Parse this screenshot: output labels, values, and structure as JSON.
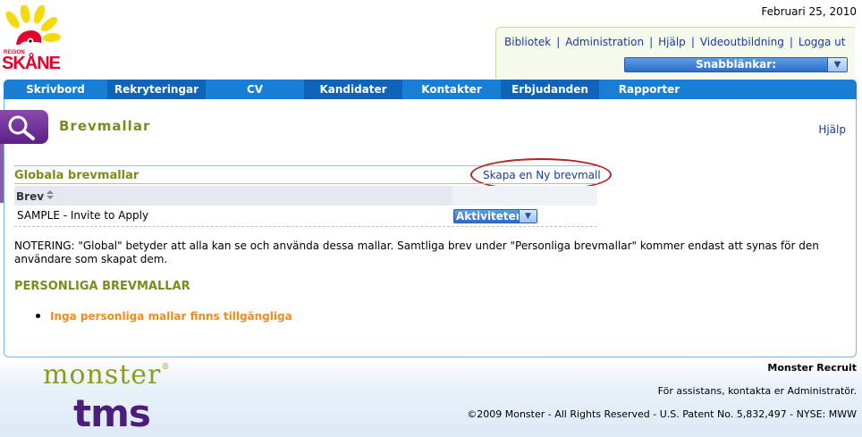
{
  "header": {
    "date": "Februari 25, 2010",
    "logo_small": "REGION",
    "logo_text": "SKÅNE",
    "links": [
      "Bibliotek",
      "Administration",
      "Hjälp",
      "Videoutbildning",
      "Logga ut"
    ],
    "quicklinks_label": "Snabblänkar:"
  },
  "nav": {
    "tabs": [
      "Skrivbord",
      "Rekryteringar",
      "CV",
      "Kandidater",
      "Kontakter",
      "Erbjudanden",
      "Rapporter"
    ]
  },
  "page": {
    "title": "Brevmallar",
    "help": "Hjälp"
  },
  "global_section": {
    "title": "Globala brevmallar",
    "create_link": "Skapa en Ny brevmall",
    "column_header": "Brev",
    "rows": [
      {
        "name": "SAMPLE - Invite to Apply",
        "action_label": "Aktiviteter"
      }
    ]
  },
  "note": "NOTERING: \"Global\" betyder att alla kan se och använda dessa mallar. Samtliga brev under \"Personliga brevmallar\" kommer endast att synas för den användare som skapat dem.",
  "personal_section": {
    "title": "PERSONLIGA BREVMALLAR",
    "empty_item": "Inga personliga mallar finns tillgängliga"
  },
  "footer": {
    "monster_logo": "monster",
    "tms_logo": "tms",
    "brand": "Monster Recruit",
    "assist": "För assistans, kontakta er Administratör.",
    "copyright": "©2009 Monster - All Rights Reserved - U.S. Patent No. 5,832,497 - NYSE: MWW"
  },
  "colors": {
    "nav_blue": "#1a7fd4",
    "nav_dark": "#0f64b7",
    "olive_title": "#7a8c1f",
    "link_blue": "#1a3b9c",
    "orange": "#f08c1e",
    "purple": "#5c1f86",
    "logo_red": "#e3002b",
    "logo_yellow": "#f5d90a"
  }
}
